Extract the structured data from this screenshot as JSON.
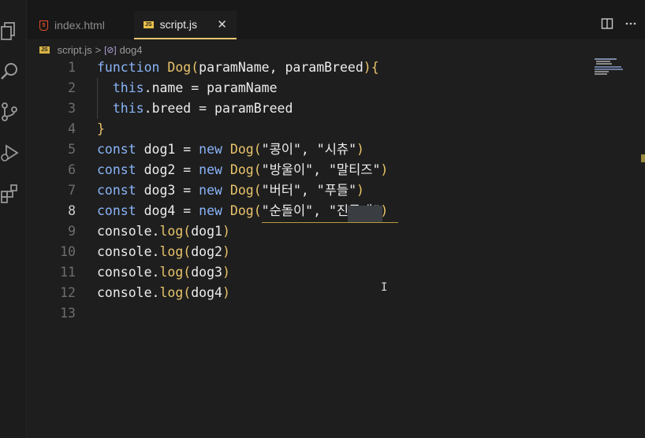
{
  "tabs": [
    {
      "label": "index.html",
      "icon": "html5-icon"
    },
    {
      "label": "script.js",
      "icon": "javascript-file-icon",
      "active": true
    }
  ],
  "tab_close_glyph": "✕",
  "breadcrumb": {
    "file": "script.js",
    "separator": ">",
    "symbol": "dog4"
  },
  "code_lines": [
    {
      "num": "1",
      "text": "function Dog(paramName, paramBreed){"
    },
    {
      "num": "2",
      "text": "  this.name = paramName"
    },
    {
      "num": "3",
      "text": "  this.breed = paramBreed"
    },
    {
      "num": "4",
      "text": "}"
    },
    {
      "num": "5",
      "text": "const dog1 = new Dog(\"콩이\", \"시츄\")"
    },
    {
      "num": "6",
      "text": "const dog2 = new Dog(\"방울이\", \"말티즈\")"
    },
    {
      "num": "7",
      "text": "const dog3 = new Dog(\"버터\", \"푸들\")"
    },
    {
      "num": "8",
      "text": "const dog4 = new Dog(\"순돌이\", \"진돗개\")"
    },
    {
      "num": "9",
      "text": "console.log(dog1)"
    },
    {
      "num": "10",
      "text": "console.log(dog2)"
    },
    {
      "num": "11",
      "text": "console.log(dog3)"
    },
    {
      "num": "12",
      "text": "console.log(dog4)"
    },
    {
      "num": "13",
      "text": ""
    }
  ],
  "active_line": "8",
  "colors": {
    "keyword": "#8ab4f8",
    "function": "#e9c46a",
    "text": "#ececec",
    "accent": "#f0c674"
  }
}
